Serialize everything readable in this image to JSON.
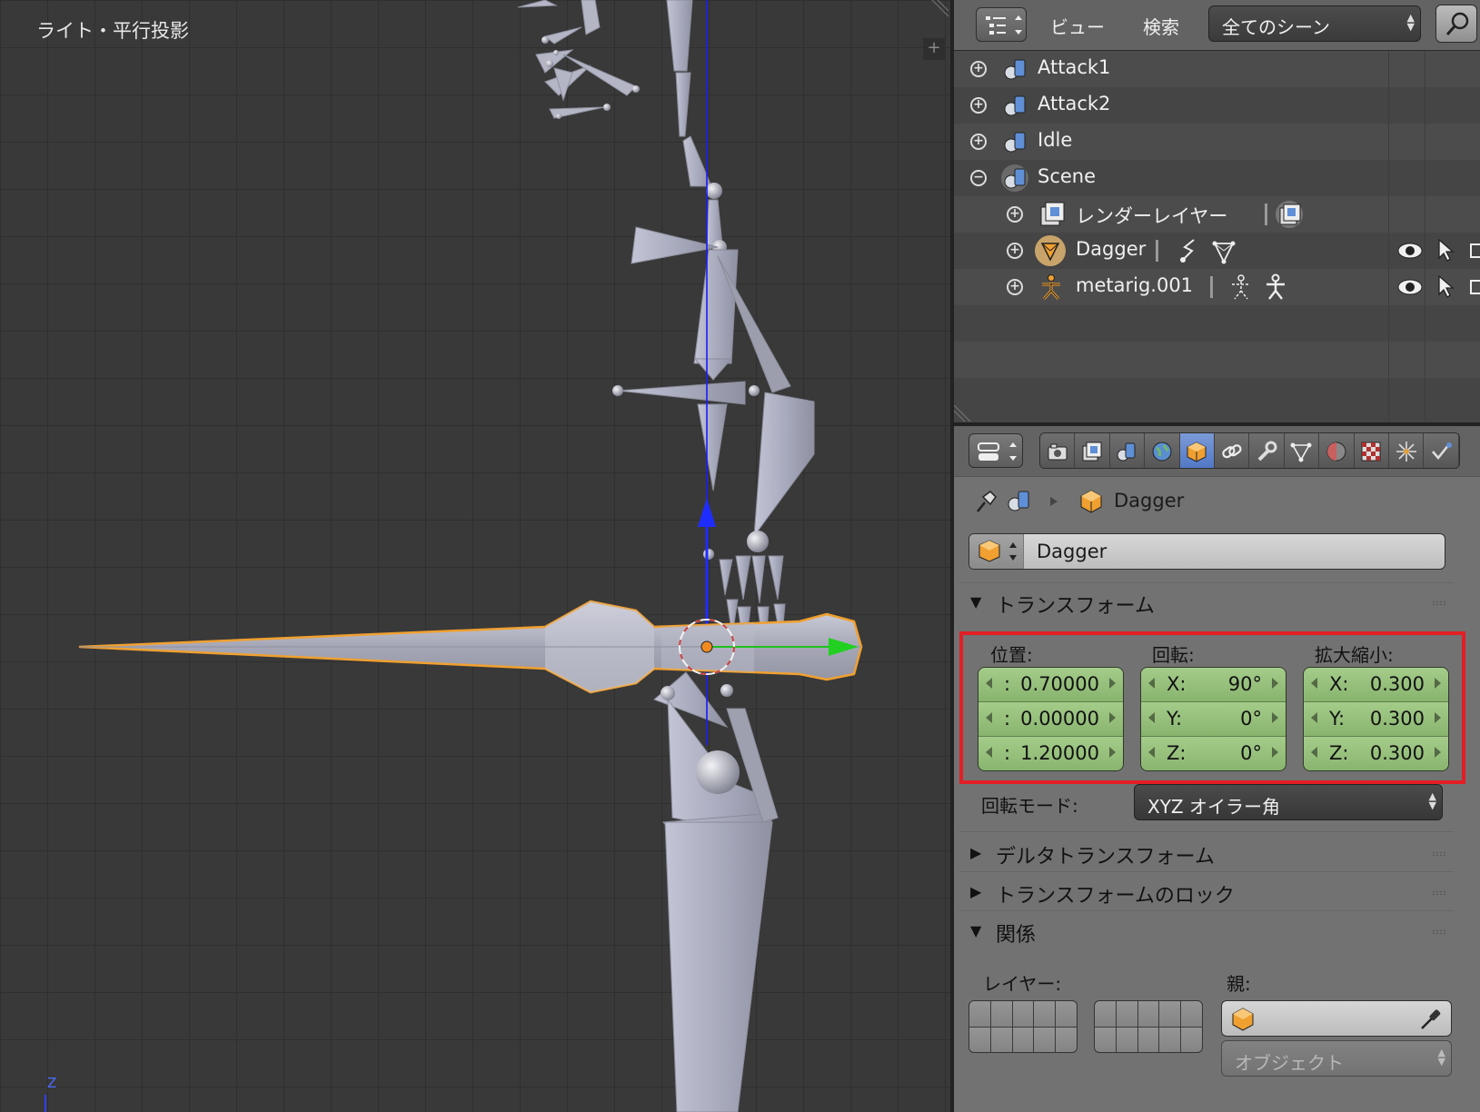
{
  "viewport": {
    "label": "ライト・平行投影",
    "axis_label": "Z",
    "plus_glyph": "+"
  },
  "outliner": {
    "menu": {
      "view": "ビュー",
      "search": "検索"
    },
    "scene_selector": "全てのシーン",
    "items": [
      {
        "label": "Attack1",
        "expanded": false,
        "indent": 0,
        "icon": "scene-icon"
      },
      {
        "label": "Attack2",
        "expanded": false,
        "indent": 0,
        "icon": "scene-icon"
      },
      {
        "label": "Idle",
        "expanded": false,
        "indent": 0,
        "icon": "scene-icon"
      },
      {
        "label": "Scene",
        "expanded": true,
        "indent": 0,
        "icon": "scene-icon"
      },
      {
        "label": "レンダーレイヤー",
        "expanded": false,
        "indent": 1,
        "icon": "render-layers-icon"
      },
      {
        "label": "Dagger",
        "expanded": false,
        "indent": 1,
        "icon": "mesh-object-icon",
        "selected": true
      },
      {
        "label": "metarig.001",
        "expanded": false,
        "indent": 1,
        "icon": "armature-icon"
      }
    ]
  },
  "properties": {
    "breadcrumb_object": "Dagger",
    "object_name": "Dagger",
    "panels": {
      "transform": "トランスフォーム",
      "delta_transform": "デルタトランスフォーム",
      "transform_lock": "トランスフォームのロック",
      "relations": "関係"
    },
    "transform": {
      "location_label": "位置:",
      "rotation_label": "回転:",
      "scale_label": "拡大縮小:",
      "location": [
        {
          "key": ":",
          "value": "0.70000"
        },
        {
          "key": ":",
          "value": "0.00000"
        },
        {
          "key": ":",
          "value": "1.20000"
        }
      ],
      "rotation": [
        {
          "key": "X:",
          "value": "90°"
        },
        {
          "key": "Y:",
          "value": "0°"
        },
        {
          "key": "Z:",
          "value": "0°"
        }
      ],
      "scale": [
        {
          "key": "X:",
          "value": "0.300"
        },
        {
          "key": "Y:",
          "value": "0.300"
        },
        {
          "key": "Z:",
          "value": "0.300"
        }
      ],
      "rotation_mode_label": "回転モード:",
      "rotation_mode": "XYZ オイラー角"
    },
    "relations": {
      "layers_label": "レイヤー:",
      "parent_label": "親:",
      "parent_type": "オブジェクト"
    }
  },
  "colors": {
    "highlight_box": "#e31e24",
    "number_field": "#98c07c",
    "active_tab": "#5680c8",
    "selection_outline": "#f0a030"
  }
}
